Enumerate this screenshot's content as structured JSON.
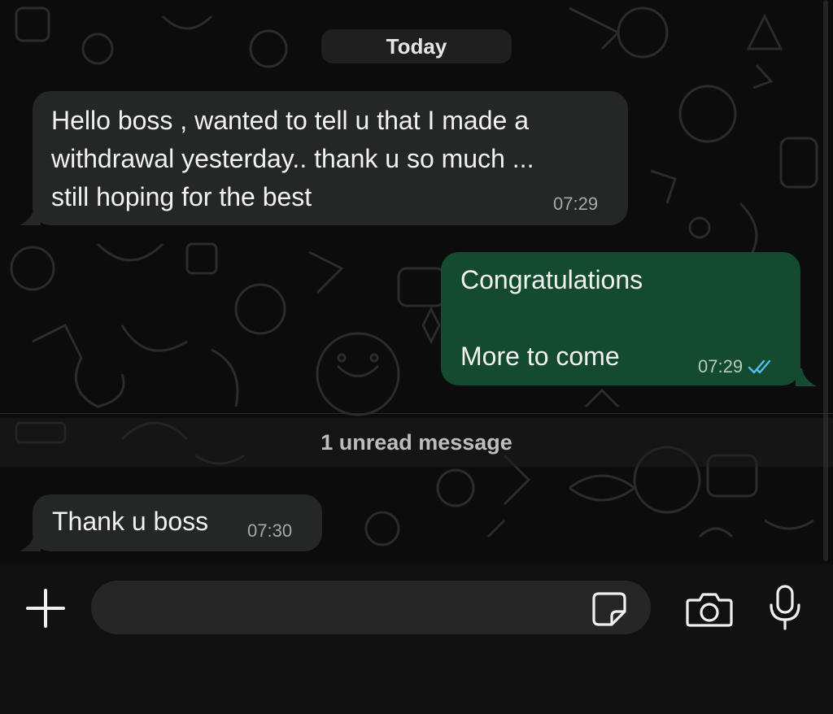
{
  "date_separator": "Today",
  "messages": [
    {
      "direction": "incoming",
      "text": "Hello boss , wanted to tell u that I made a\nwithdrawal yesterday.. thank u so much ...\nstill hoping for the best",
      "time": "07:29"
    },
    {
      "direction": "outgoing",
      "text": "Congratulations\n\nMore to come",
      "time": "07:29",
      "status": "read",
      "status_icon": "double-check-icon"
    },
    {
      "direction": "incoming",
      "text": "Thank u boss",
      "time": "07:30"
    }
  ],
  "unread_banner": "1 unread message",
  "composer": {
    "input_value": "",
    "placeholder": "",
    "icons": [
      "plus-icon",
      "sticker-icon",
      "camera-icon",
      "microphone-icon"
    ]
  },
  "colors": {
    "background": "#0c0c0c",
    "incoming_bubble": "#252626",
    "outgoing_bubble": "#144b2e",
    "read_tick": "#53bdeb"
  }
}
